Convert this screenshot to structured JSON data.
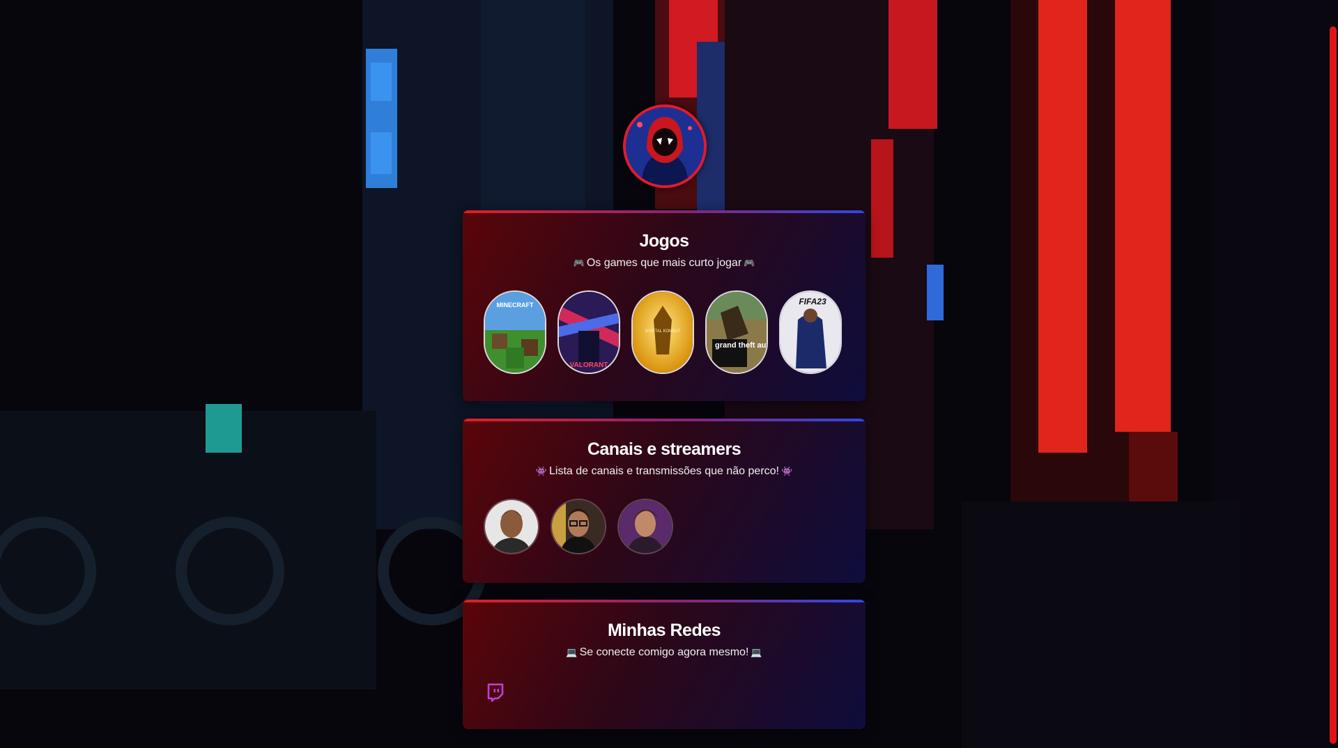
{
  "profile": {
    "avatar_name": "Spider-Man Miles Morales hooded avatar"
  },
  "games_section": {
    "title": "Jogos",
    "subtitle": "Os games que mais curto jogar",
    "emoji": "🎮",
    "items": [
      {
        "name": "Minecraft",
        "label": "MINECRAFT"
      },
      {
        "name": "Valorant",
        "label": "VALORANT"
      },
      {
        "name": "Mortal Kombat 11",
        "label": "MORTAL KOMBAT"
      },
      {
        "name": "Grand Theft Auto V",
        "label": "grand theft auto"
      },
      {
        "name": "FIFA 23",
        "label": "FIFA23"
      }
    ]
  },
  "streamers_section": {
    "title": "Canais e streamers",
    "subtitle": "Lista de canais e transmissões que não perco!",
    "emoji": "👾",
    "items": [
      {
        "name": "streamer-1"
      },
      {
        "name": "streamer-2"
      },
      {
        "name": "streamer-3"
      }
    ]
  },
  "social_section": {
    "title": "Minhas Redes",
    "subtitle": "Se conecte comigo agora mesmo!",
    "emoji": "💻",
    "links": [
      {
        "name": "twitch",
        "icon": "twitch-icon",
        "color": "#c43ed8"
      }
    ]
  },
  "colors": {
    "accent_red": "#e31e24",
    "accent_blue": "#2e48e6",
    "scrollbar": "#e01414"
  }
}
